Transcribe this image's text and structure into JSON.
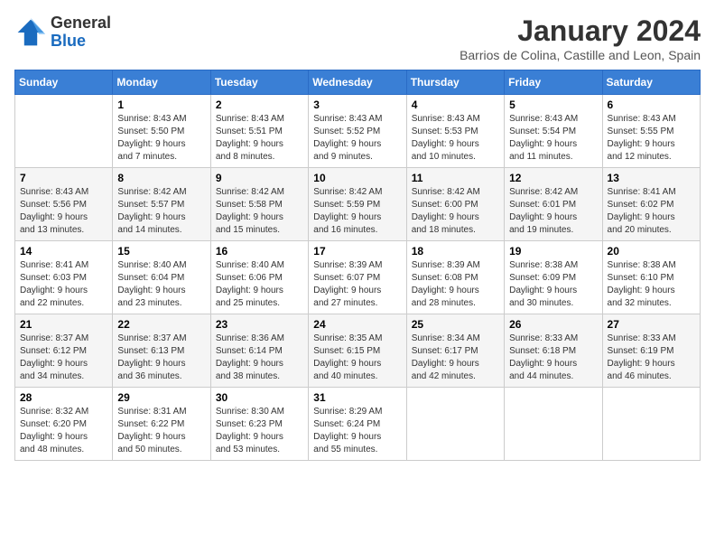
{
  "header": {
    "logo_general": "General",
    "logo_blue": "Blue",
    "month_title": "January 2024",
    "subtitle": "Barrios de Colina, Castille and Leon, Spain"
  },
  "days_of_week": [
    "Sunday",
    "Monday",
    "Tuesday",
    "Wednesday",
    "Thursday",
    "Friday",
    "Saturday"
  ],
  "weeks": [
    [
      {
        "day": "",
        "info": ""
      },
      {
        "day": "1",
        "info": "Sunrise: 8:43 AM\nSunset: 5:50 PM\nDaylight: 9 hours\nand 7 minutes."
      },
      {
        "day": "2",
        "info": "Sunrise: 8:43 AM\nSunset: 5:51 PM\nDaylight: 9 hours\nand 8 minutes."
      },
      {
        "day": "3",
        "info": "Sunrise: 8:43 AM\nSunset: 5:52 PM\nDaylight: 9 hours\nand 9 minutes."
      },
      {
        "day": "4",
        "info": "Sunrise: 8:43 AM\nSunset: 5:53 PM\nDaylight: 9 hours\nand 10 minutes."
      },
      {
        "day": "5",
        "info": "Sunrise: 8:43 AM\nSunset: 5:54 PM\nDaylight: 9 hours\nand 11 minutes."
      },
      {
        "day": "6",
        "info": "Sunrise: 8:43 AM\nSunset: 5:55 PM\nDaylight: 9 hours\nand 12 minutes."
      }
    ],
    [
      {
        "day": "7",
        "info": "Sunrise: 8:43 AM\nSunset: 5:56 PM\nDaylight: 9 hours\nand 13 minutes."
      },
      {
        "day": "8",
        "info": "Sunrise: 8:42 AM\nSunset: 5:57 PM\nDaylight: 9 hours\nand 14 minutes."
      },
      {
        "day": "9",
        "info": "Sunrise: 8:42 AM\nSunset: 5:58 PM\nDaylight: 9 hours\nand 15 minutes."
      },
      {
        "day": "10",
        "info": "Sunrise: 8:42 AM\nSunset: 5:59 PM\nDaylight: 9 hours\nand 16 minutes."
      },
      {
        "day": "11",
        "info": "Sunrise: 8:42 AM\nSunset: 6:00 PM\nDaylight: 9 hours\nand 18 minutes."
      },
      {
        "day": "12",
        "info": "Sunrise: 8:42 AM\nSunset: 6:01 PM\nDaylight: 9 hours\nand 19 minutes."
      },
      {
        "day": "13",
        "info": "Sunrise: 8:41 AM\nSunset: 6:02 PM\nDaylight: 9 hours\nand 20 minutes."
      }
    ],
    [
      {
        "day": "14",
        "info": "Sunrise: 8:41 AM\nSunset: 6:03 PM\nDaylight: 9 hours\nand 22 minutes."
      },
      {
        "day": "15",
        "info": "Sunrise: 8:40 AM\nSunset: 6:04 PM\nDaylight: 9 hours\nand 23 minutes."
      },
      {
        "day": "16",
        "info": "Sunrise: 8:40 AM\nSunset: 6:06 PM\nDaylight: 9 hours\nand 25 minutes."
      },
      {
        "day": "17",
        "info": "Sunrise: 8:39 AM\nSunset: 6:07 PM\nDaylight: 9 hours\nand 27 minutes."
      },
      {
        "day": "18",
        "info": "Sunrise: 8:39 AM\nSunset: 6:08 PM\nDaylight: 9 hours\nand 28 minutes."
      },
      {
        "day": "19",
        "info": "Sunrise: 8:38 AM\nSunset: 6:09 PM\nDaylight: 9 hours\nand 30 minutes."
      },
      {
        "day": "20",
        "info": "Sunrise: 8:38 AM\nSunset: 6:10 PM\nDaylight: 9 hours\nand 32 minutes."
      }
    ],
    [
      {
        "day": "21",
        "info": "Sunrise: 8:37 AM\nSunset: 6:12 PM\nDaylight: 9 hours\nand 34 minutes."
      },
      {
        "day": "22",
        "info": "Sunrise: 8:37 AM\nSunset: 6:13 PM\nDaylight: 9 hours\nand 36 minutes."
      },
      {
        "day": "23",
        "info": "Sunrise: 8:36 AM\nSunset: 6:14 PM\nDaylight: 9 hours\nand 38 minutes."
      },
      {
        "day": "24",
        "info": "Sunrise: 8:35 AM\nSunset: 6:15 PM\nDaylight: 9 hours\nand 40 minutes."
      },
      {
        "day": "25",
        "info": "Sunrise: 8:34 AM\nSunset: 6:17 PM\nDaylight: 9 hours\nand 42 minutes."
      },
      {
        "day": "26",
        "info": "Sunrise: 8:33 AM\nSunset: 6:18 PM\nDaylight: 9 hours\nand 44 minutes."
      },
      {
        "day": "27",
        "info": "Sunrise: 8:33 AM\nSunset: 6:19 PM\nDaylight: 9 hours\nand 46 minutes."
      }
    ],
    [
      {
        "day": "28",
        "info": "Sunrise: 8:32 AM\nSunset: 6:20 PM\nDaylight: 9 hours\nand 48 minutes."
      },
      {
        "day": "29",
        "info": "Sunrise: 8:31 AM\nSunset: 6:22 PM\nDaylight: 9 hours\nand 50 minutes."
      },
      {
        "day": "30",
        "info": "Sunrise: 8:30 AM\nSunset: 6:23 PM\nDaylight: 9 hours\nand 53 minutes."
      },
      {
        "day": "31",
        "info": "Sunrise: 8:29 AM\nSunset: 6:24 PM\nDaylight: 9 hours\nand 55 minutes."
      },
      {
        "day": "",
        "info": ""
      },
      {
        "day": "",
        "info": ""
      },
      {
        "day": "",
        "info": ""
      }
    ]
  ],
  "row_styles": [
    "row-white",
    "row-shaded",
    "row-white",
    "row-shaded",
    "row-white"
  ]
}
